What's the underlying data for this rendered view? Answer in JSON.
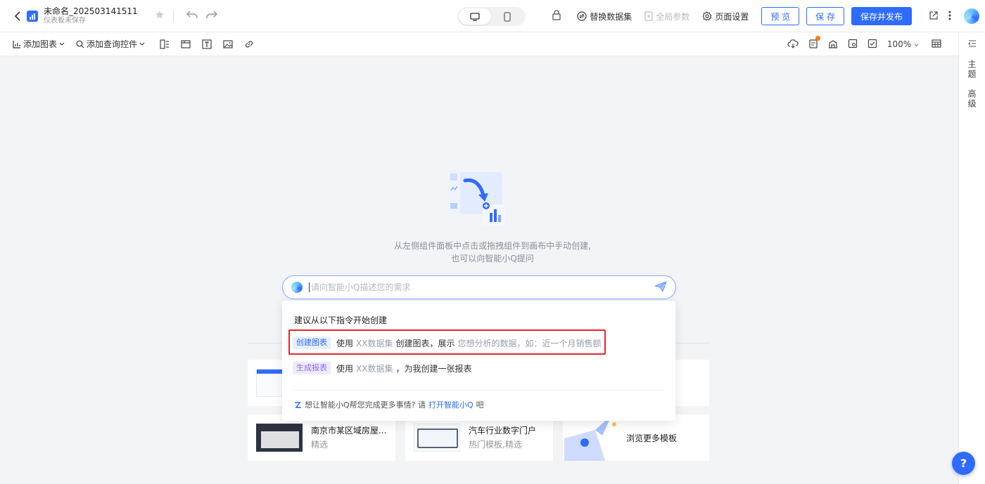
{
  "header": {
    "title": "未命名_202503141511",
    "subtitle": "仪表板未保存",
    "replace_dataset": "替换数据集",
    "global_params": "全局参数",
    "page_settings": "页面设置",
    "preview": "预 览",
    "save": "保 存",
    "save_publish": "保存并发布"
  },
  "toolbar": {
    "add_chart": "添加图表",
    "add_query": "添加查询控件",
    "zoom": "100%"
  },
  "right_panel": {
    "theme": "主题",
    "advanced": "高级"
  },
  "canvas": {
    "hint_line1": "从左侧组件面板中点击或拖拽组件到画布中手动创建,",
    "hint_line2": "也可以向智能小Q提问",
    "ask_placeholder": "请向智能小Q描述您的需求"
  },
  "suggest": {
    "title": "建议从以下指令开始创建",
    "row1": {
      "tag": "创建图表",
      "p1": "使用",
      "g1": "XX数据集",
      "p2": "创建图表，展示",
      "g2": "您想分析的数据，如：近一个月销售额"
    },
    "row2": {
      "tag": "生成报表",
      "p1": "使用",
      "g1": "XX数据集",
      "p2": "，为我创建一张报表"
    },
    "footer_pre": "想让智能小Q帮您完成更多事情? 请",
    "footer_link": "打开智能小Q",
    "footer_post": "吧"
  },
  "templates": [
    {
      "name": "南京市某区域房屋...",
      "sub": "精选"
    },
    {
      "name": "汽车行业数字门户",
      "sub": "热门模板,精选"
    }
  ],
  "browse_more": "浏览更多模板",
  "colors": {
    "accent": "#2f6bff",
    "highlight_box": "#e0282e"
  }
}
